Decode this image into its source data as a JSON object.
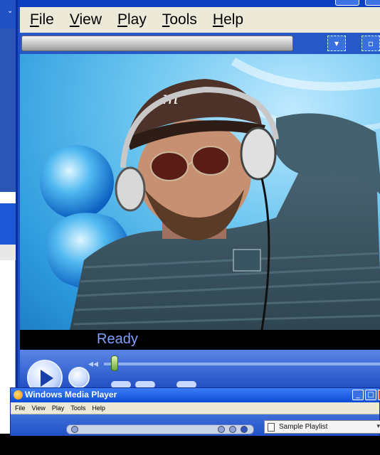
{
  "main_window": {
    "menu": [
      "File",
      "View",
      "Play",
      "Tools",
      "Help"
    ],
    "status_text": "Ready"
  },
  "second_window": {
    "title": "Windows Media Player",
    "menu": [
      "File",
      "View",
      "Play",
      "Tools",
      "Help"
    ],
    "playlist_label": "Sample Playlist"
  },
  "colors": {
    "xp_blue": "#1e4fc7",
    "menubar": "#ece9d8",
    "status_text": "#7fa0ff"
  },
  "icons": {
    "play": "play-icon",
    "stop": "stop-icon",
    "rewind": "rewind-icon",
    "playlist": "playlist-icon"
  }
}
